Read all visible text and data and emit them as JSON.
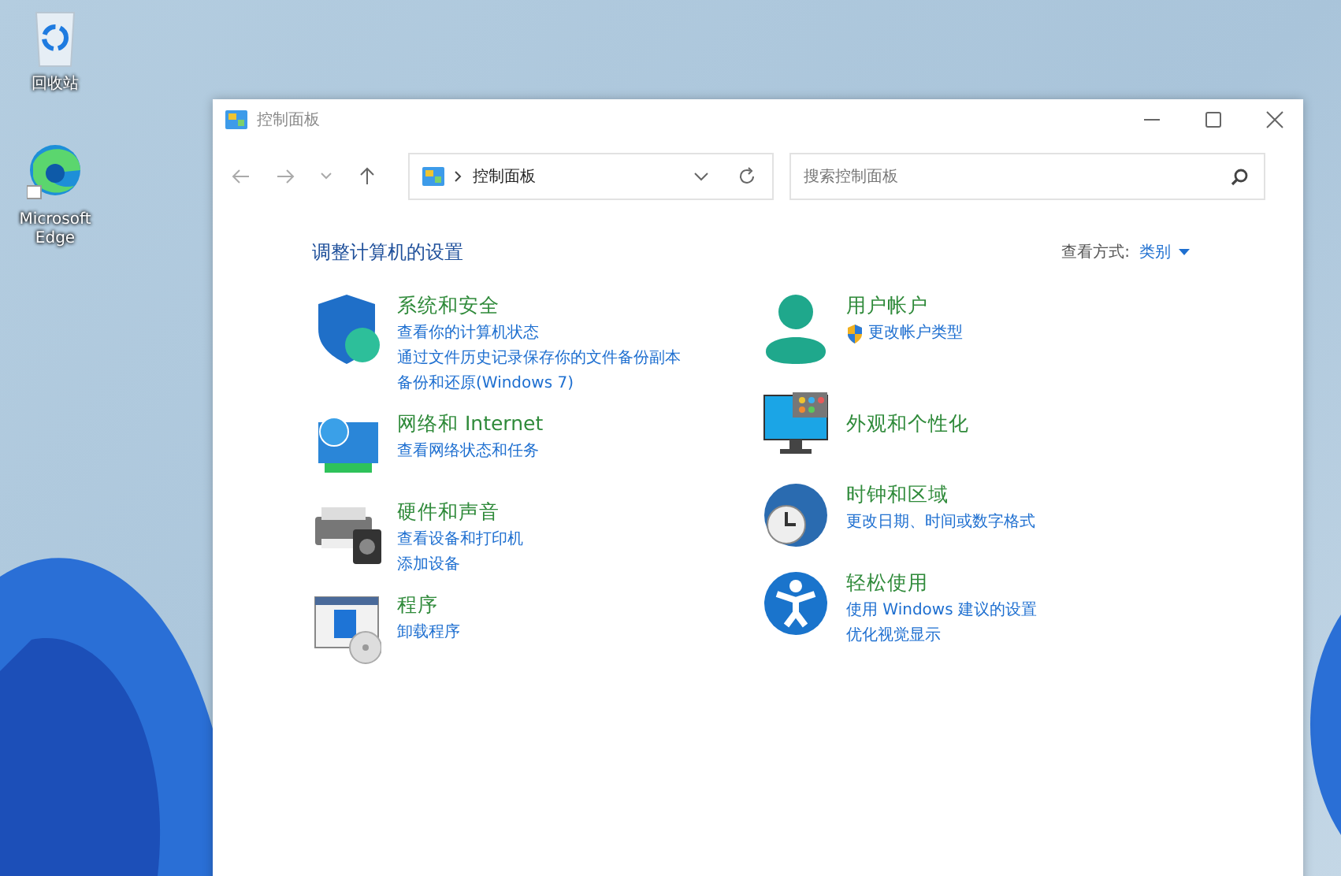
{
  "desktop_icons": [
    {
      "label": "回收站",
      "kind": "recycle"
    },
    {
      "label": "Microsoft Edge",
      "kind": "edge"
    }
  ],
  "window": {
    "title": "控制面板",
    "address": "控制面板",
    "search": {
      "placeholder": "搜索控制面板"
    },
    "heading": "调整计算机的设置",
    "view_by": {
      "label": "查看方式:",
      "value": "类别"
    },
    "columns": [
      [
        {
          "title": "系统和安全",
          "kind": "shield",
          "links": [
            {
              "text": "查看你的计算机状态",
              "shield": false
            },
            {
              "text": "通过文件历史记录保存你的文件备份副本",
              "shield": false
            },
            {
              "text": "备份和还原(Windows 7)",
              "shield": false
            }
          ]
        },
        {
          "title": "网络和 Internet",
          "kind": "network",
          "links": [
            {
              "text": "查看网络状态和任务",
              "shield": false
            }
          ]
        },
        {
          "title": "硬件和声音",
          "kind": "printer",
          "links": [
            {
              "text": "查看设备和打印机",
              "shield": false
            },
            {
              "text": "添加设备",
              "shield": false
            }
          ]
        },
        {
          "title": "程序",
          "kind": "programs",
          "links": [
            {
              "text": "卸载程序",
              "shield": false
            }
          ]
        }
      ],
      [
        {
          "title": "用户帐户",
          "kind": "user",
          "links": [
            {
              "text": "更改帐户类型",
              "shield": true
            }
          ]
        },
        {
          "title": "外观和个性化",
          "kind": "monitor"
        },
        {
          "title": "时钟和区域",
          "kind": "clock",
          "links": [
            {
              "text": "更改日期、时间或数字格式",
              "shield": false
            }
          ]
        },
        {
          "title": "轻松使用",
          "kind": "access",
          "links": [
            {
              "text": "使用 Windows 建议的设置",
              "shield": false
            },
            {
              "text": "优化视觉显示",
              "shield": false
            }
          ]
        }
      ]
    ]
  }
}
